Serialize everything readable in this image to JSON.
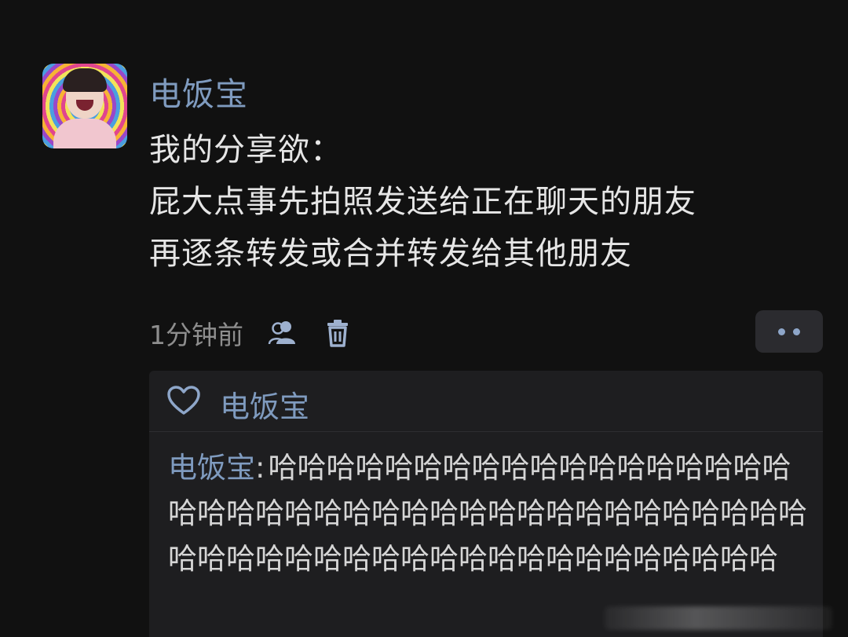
{
  "post": {
    "username": "电饭宝",
    "lines": [
      "我的分享欲：",
      "屁大点事先拍照发送给正在聊天的朋友",
      "再逐条转发或合并转发给其他朋友"
    ],
    "timestamp": "1分钟前",
    "icons": {
      "visibility": "friends-icon",
      "delete": "trash-icon",
      "more": "more-dots-icon",
      "like": "heart-icon"
    }
  },
  "likes": {
    "names": "电饭宝"
  },
  "comments": [
    {
      "author": "电饭宝",
      "colon": ":",
      "text": "哈哈哈哈哈哈哈哈哈哈哈哈哈哈哈哈哈哈哈哈哈哈哈哈哈哈哈哈哈哈哈哈哈哈哈哈哈哈哈哈哈哈哈哈哈哈哈哈哈哈哈哈哈哈哈哈哈哈哈哈哈"
    }
  ],
  "colors": {
    "background": "#111111",
    "name_link": "#7f9bbf",
    "panel": "#1e1e20",
    "more_button": "#2b2b2f"
  }
}
